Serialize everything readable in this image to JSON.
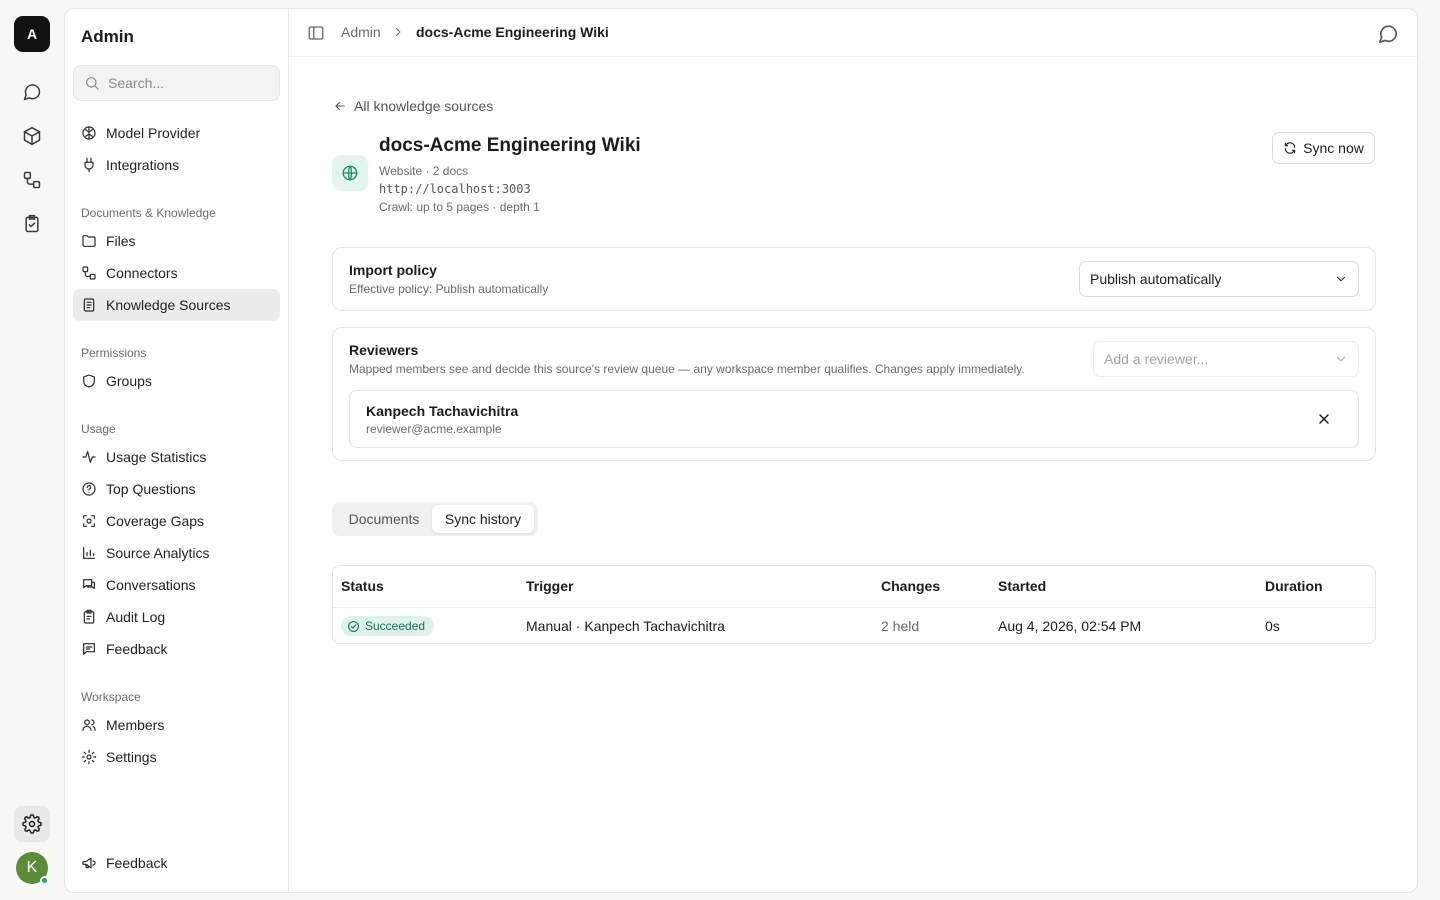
{
  "rail": {
    "logo_letter": "A",
    "avatar_letter": "K",
    "icons": [
      "chat-icon",
      "cube-icon",
      "connectors-icon",
      "clipboard-check-icon",
      "settings-icon"
    ]
  },
  "sidebar": {
    "title": "Admin",
    "search_placeholder": "Search...",
    "top_items": [
      {
        "label": "Model Provider",
        "icon": "brain-icon"
      },
      {
        "label": "Integrations",
        "icon": "plug-icon"
      }
    ],
    "sections": {
      "documents": "Documents & Knowledge",
      "permissions": "Permissions",
      "usage": "Usage",
      "workspace": "Workspace"
    },
    "documents_items": [
      {
        "label": "Files",
        "icon": "folder-icon"
      },
      {
        "label": "Connectors",
        "icon": "connectors-icon"
      },
      {
        "label": "Knowledge Sources",
        "icon": "book-icon",
        "active": true
      }
    ],
    "permissions_items": [
      {
        "label": "Groups",
        "icon": "shield-icon"
      }
    ],
    "usage_items": [
      {
        "label": "Usage Statistics",
        "icon": "activity-icon"
      },
      {
        "label": "Top Questions",
        "icon": "question-icon"
      },
      {
        "label": "Coverage Gaps",
        "icon": "scan-icon"
      },
      {
        "label": "Source Analytics",
        "icon": "bar-chart-icon"
      },
      {
        "label": "Conversations",
        "icon": "messages-icon"
      },
      {
        "label": "Audit Log",
        "icon": "clipboard-icon"
      },
      {
        "label": "Feedback",
        "icon": "message-text-icon"
      }
    ],
    "workspace_items": [
      {
        "label": "Members",
        "icon": "users-icon"
      },
      {
        "label": "Settings",
        "icon": "gear-icon"
      }
    ],
    "footer_feedback": "Feedback"
  },
  "header": {
    "crumb_admin": "Admin",
    "crumb_current": "docs-Acme Engineering Wiki"
  },
  "source": {
    "back_label": "All knowledge sources",
    "title": "docs-Acme Engineering Wiki",
    "meta": "Website · 2 docs",
    "url": "http://localhost:3003",
    "crawl": "Crawl: up to 5 pages · depth 1",
    "sync_label": "Sync now"
  },
  "import_policy": {
    "title": "Import policy",
    "subtitle": "Effective policy: Publish automatically",
    "selected": "Publish automatically"
  },
  "reviewers": {
    "title": "Reviewers",
    "subtitle": "Mapped members see and decide this source's review queue — any workspace member qualifies. Changes apply immediately.",
    "add_placeholder": "Add a reviewer...",
    "list": [
      {
        "name": "Kanpech Tachavichitra",
        "email": "reviewer@acme.example"
      }
    ]
  },
  "tabs": [
    {
      "label": "Documents",
      "active": false
    },
    {
      "label": "Sync history",
      "active": true
    }
  ],
  "sync_table": {
    "headers": [
      "Status",
      "Trigger",
      "Changes",
      "Started",
      "Duration"
    ],
    "rows": [
      {
        "status": "Succeeded",
        "trigger": "Manual · Kanpech Tachavichitra",
        "changes": "2 held",
        "started": "Aug 4, 2026, 02:54 PM",
        "duration": "0s"
      }
    ]
  },
  "colors": {
    "accent_green": "#1f8a6a",
    "badge_bg": "#ddf3ea",
    "avatar": "#5b8c3a"
  }
}
